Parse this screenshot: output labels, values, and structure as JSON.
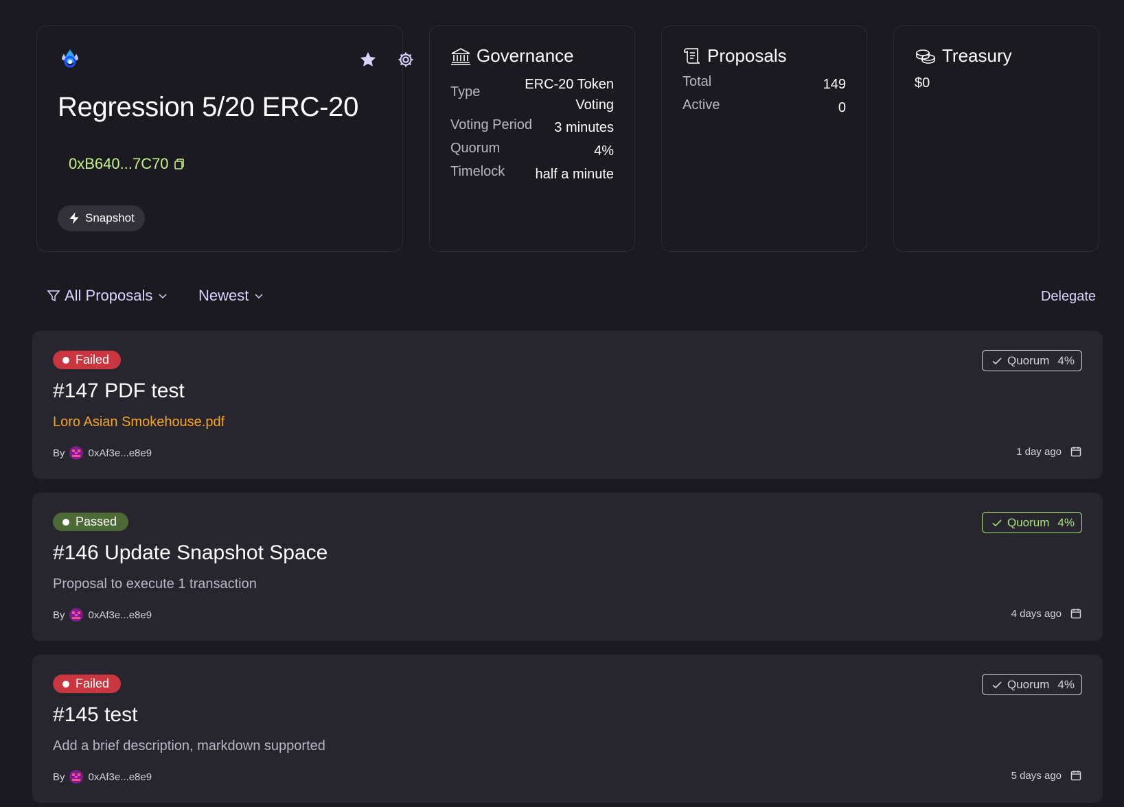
{
  "dao": {
    "name": "Regression 5/20 ERC-20",
    "address": "0xB640...7C70",
    "snapshot_label": "Snapshot",
    "icons": {
      "logo": "dao-logo-icon",
      "star": "star-icon",
      "settings": "gear-icon",
      "copy": "copy-icon",
      "snapshot": "lightning-icon"
    }
  },
  "governance": {
    "title": "Governance",
    "rows": [
      {
        "label": "Type",
        "value": "ERC-20 Token Voting"
      },
      {
        "label": "Voting Period",
        "value": "3 minutes"
      },
      {
        "label": "Quorum",
        "value": "4%"
      },
      {
        "label": "Timelock",
        "value": "half a minute"
      }
    ]
  },
  "proposals_summary": {
    "title": "Proposals",
    "rows": [
      {
        "label": "Total",
        "value": "149"
      },
      {
        "label": "Active",
        "value": "0"
      }
    ]
  },
  "treasury": {
    "title": "Treasury",
    "value": "$0"
  },
  "filters": {
    "all_label": "All Proposals",
    "sort_label": "Newest",
    "delegate_label": "Delegate"
  },
  "proposals": [
    {
      "status": "Failed",
      "title": "#147 PDF test",
      "description": "Loro Asian Smokehouse.pdf",
      "by_label": "By",
      "author": "0xAf3e...e8e9",
      "quorum_label": "Quorum",
      "quorum_value": "4%",
      "date": "1 day ago"
    },
    {
      "status": "Passed",
      "title": "#146 Update Snapshot Space",
      "description": "Proposal to execute 1 transaction",
      "by_label": "By",
      "author": "0xAf3e...e8e9",
      "quorum_label": "Quorum",
      "quorum_value": "4%",
      "date": "4 days ago"
    },
    {
      "status": "Failed",
      "title": "#145 test",
      "description": "Add a brief description, markdown supported",
      "by_label": "By",
      "author": "0xAf3e...e8e9",
      "quorum_label": "Quorum",
      "quorum_value": "4%",
      "date": "5 days ago"
    }
  ],
  "colors": {
    "background": "#1b1a20",
    "card": "#27252d",
    "accent_lavender": "#d9d4ff",
    "address_green": "#c6f28a",
    "failed_red": "#c9363f",
    "passed_green": "#4d6a36",
    "quorum_ok": "#a8e07a",
    "file_orange": "#f5a623"
  }
}
